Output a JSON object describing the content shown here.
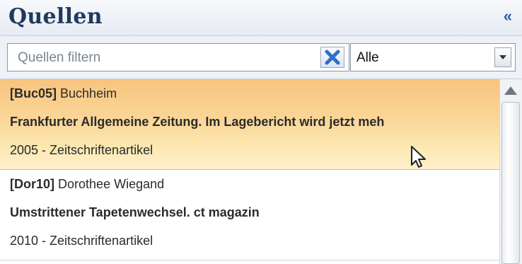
{
  "panel": {
    "title": "Quellen",
    "collapse_label": "«"
  },
  "filter": {
    "placeholder": "Quellen filtern",
    "value": "",
    "clear_icon": "x-icon",
    "select_value": "Alle",
    "select_arrow_icon": "chevron-down-icon"
  },
  "sources": [
    {
      "key": "[Buc05]",
      "author": "Buchheim",
      "title": "Frankfurter Allgemeine Zeitung. Im Lagebericht wird jetzt meh",
      "meta": "2005 - Zeitschriftenartikel",
      "selected": true
    },
    {
      "key": "[Dor10]",
      "author": "Dorothee Wiegand",
      "title": "Umstrittener Tapetenwechsel. ct magazin",
      "meta": "2010 - Zeitschriftenartikel",
      "selected": false
    }
  ],
  "colors": {
    "title": "#1f3a5c",
    "accent": "#2b5fa5",
    "selection_top": "#f8c47f",
    "selection_bottom": "#fdf0cc",
    "clear_icon": "#2d6fc9"
  },
  "icons": {
    "collapse": "double-chevron-left-icon",
    "scroll_up": "arrow-up-icon",
    "cursor": "mouse-pointer-icon"
  }
}
